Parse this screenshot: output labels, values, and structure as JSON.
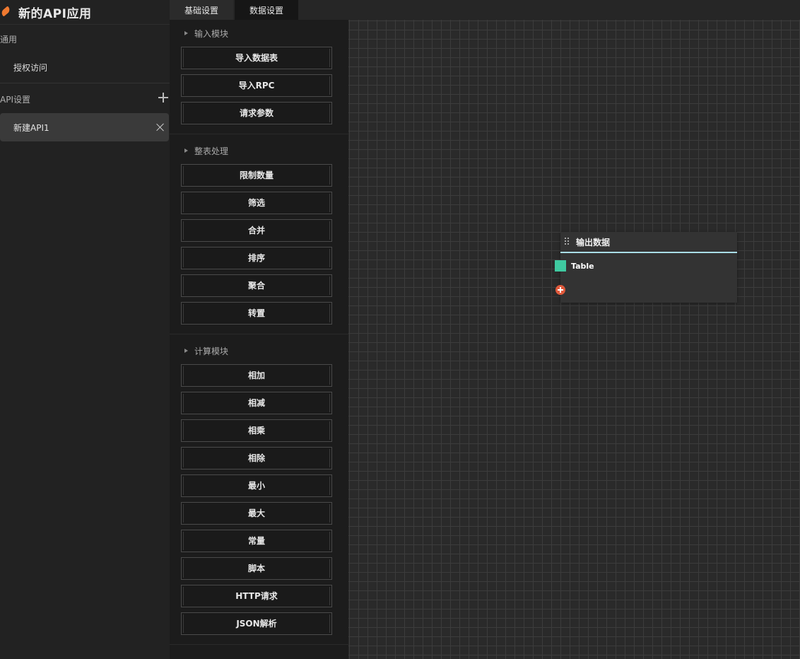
{
  "app": {
    "title": "新的API应用"
  },
  "sidebar": {
    "general_title": "通用",
    "general_items": [
      {
        "label": "授权访问"
      }
    ],
    "api_title": "API设置",
    "api_items": [
      {
        "label": "新建API1"
      }
    ]
  },
  "tabs": [
    {
      "label": "基础设置"
    },
    {
      "label": "数据设置",
      "active": true
    }
  ],
  "modules": {
    "input": {
      "title": "输入模块",
      "buttons": [
        "导入数据表",
        "导入RPC",
        "请求参数"
      ]
    },
    "table": {
      "title": "整表处理",
      "buttons": [
        "限制数量",
        "筛选",
        "合并",
        "排序",
        "聚合",
        "转置"
      ]
    },
    "compute": {
      "title": "计算模块",
      "buttons": [
        "相加",
        "相减",
        "相乘",
        "相除",
        "最小",
        "最大",
        "常量",
        "脚本",
        "HTTP请求",
        "JSON解析"
      ]
    }
  },
  "canvas": {
    "node": {
      "title": "输出数据",
      "port_label": "Table",
      "port_color": "#3fc9a0",
      "accent_color": "#a9dde6"
    }
  }
}
